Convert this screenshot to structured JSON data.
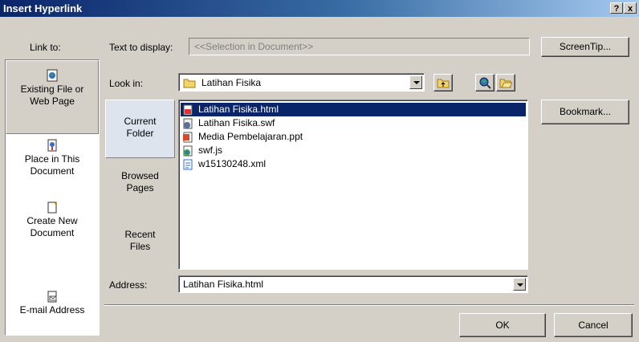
{
  "window": {
    "title": "Insert Hyperlink",
    "help_label": "?",
    "close_label": "x"
  },
  "link_to": {
    "header": "Link to:",
    "items": [
      {
        "label_line1": "Existing File or",
        "label_line2": "Web Page",
        "icon": "web-page-icon"
      },
      {
        "label_line1": "Place in This",
        "label_line2": "Document",
        "icon": "document-place-icon"
      },
      {
        "label_line1": "Create New",
        "label_line2": "Document",
        "icon": "new-document-icon"
      },
      {
        "label_line1": "E-mail Address",
        "label_line2": "",
        "icon": "email-icon"
      }
    ]
  },
  "text_to_display": {
    "label": "Text to display:",
    "value": "<<Selection in Document>>"
  },
  "screentip_label": "ScreenTip...",
  "look_in": {
    "label": "Look in:",
    "value": "Latihan Fisika"
  },
  "nav": [
    {
      "line1": "Current",
      "line2": "Folder"
    },
    {
      "line1": "Browsed",
      "line2": "Pages"
    },
    {
      "line1": "Recent",
      "line2": "Files"
    }
  ],
  "files": [
    {
      "name": "Latihan Fisika.html",
      "icon": "html-file-icon"
    },
    {
      "name": "Latihan Fisika.swf",
      "icon": "swf-file-icon"
    },
    {
      "name": "Media Pembelajaran.ppt",
      "icon": "ppt-file-icon"
    },
    {
      "name": "swf.js",
      "icon": "js-file-icon"
    },
    {
      "name": "w15130248.xml",
      "icon": "xml-file-icon"
    }
  ],
  "bookmark_label": "Bookmark...",
  "address": {
    "label": "Address:",
    "value": "Latihan Fisika.html"
  },
  "ok_label": "OK",
  "cancel_label": "Cancel"
}
